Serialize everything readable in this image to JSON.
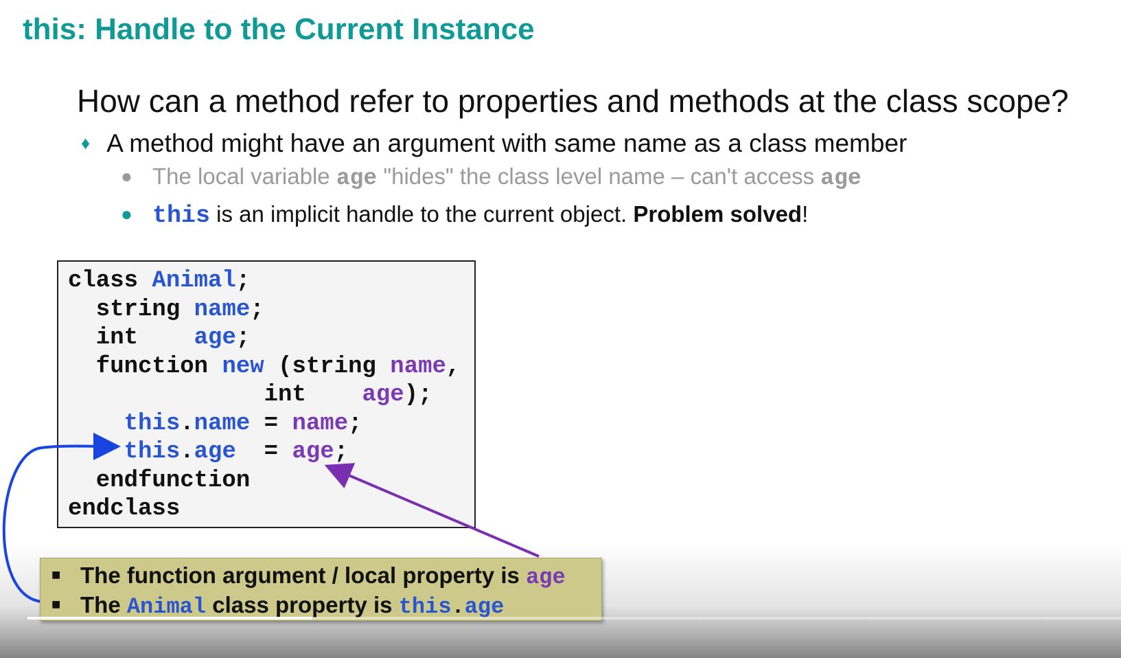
{
  "slide": {
    "title": "this: Handle to the Current Instance",
    "question": "How can a method refer to properties and methods at the class scope?",
    "bullet": "A method might have an argument with same name as a class member",
    "sub1": {
      "text_a": "The local variable ",
      "code_a": "age",
      "text_b": " \"hides\" the class level name – can't access ",
      "code_b": "age"
    },
    "sub2": {
      "code": "this",
      "text_a": " is an implicit handle to the current object. ",
      "bold": "Problem solved",
      "text_b": "!"
    }
  },
  "code": {
    "l1a": "class ",
    "l1b": "Animal",
    "l1c": ";",
    "l2a": "  string ",
    "l2b": "name",
    "l2c": ";",
    "l3a": "  int    ",
    "l3b": "age",
    "l3c": ";",
    "l4a": "  function ",
    "l4b": "new",
    "l4c": " (string ",
    "l4d": "name",
    "l4e": ",",
    "l5a": "              int    ",
    "l5b": "age",
    "l5c": ");",
    "l6a": "    ",
    "l6b": "this",
    "l6c": ".",
    "l6d": "name",
    "l6e": " = ",
    "l6f": "name",
    "l6g": ";",
    "l7a": "    ",
    "l7b": "this",
    "l7c": ".",
    "l7d": "age",
    "l7e": "  = ",
    "l7f": "age",
    "l7g": ";",
    "l8": "  endfunction",
    "l9": "endclass"
  },
  "note": {
    "line1_text": "The function argument / local property is ",
    "line1_code": "age",
    "line2_text_a": "The ",
    "line2_code_a": "Animal",
    "line2_text_b": " class property is ",
    "line2_code_b": "this",
    "line2_code_c": ".",
    "line2_code_d": "age"
  },
  "colors": {
    "title": "#0f9a96",
    "keyword_blue": "#2a55d0",
    "argument_purple": "#7a3ab3",
    "note_background": "#cdc98a"
  },
  "icons": {
    "bullet": "teal-diamond",
    "sub_bullet": "dot",
    "note_bullet": "black-square"
  },
  "video_progress": 0.26
}
